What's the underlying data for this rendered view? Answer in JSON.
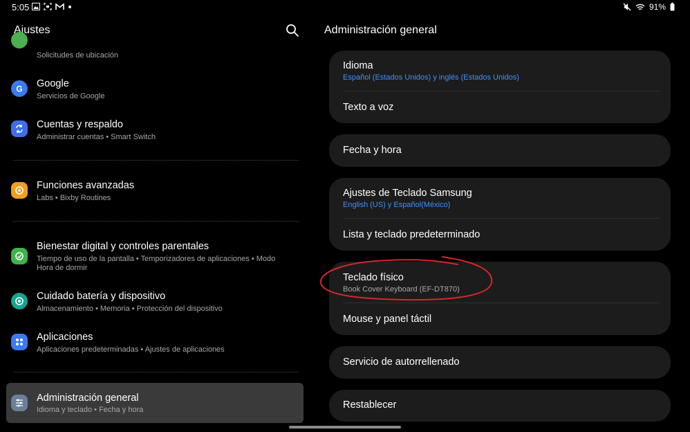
{
  "status_bar": {
    "time": "5:05",
    "battery": "91%",
    "left_icons": [
      "image-icon",
      "screenshot-icon",
      "gmail-icon",
      "dot-icon"
    ],
    "right_icons": [
      "mute-icon",
      "wifi-icon",
      "battery-icon"
    ]
  },
  "left_panel": {
    "title": "Ajustes",
    "items": [
      {
        "title": "",
        "subtitle": "Solicitudes de ubicación",
        "icon": "location-icon",
        "color": "#4caf50"
      },
      {
        "title": "Google",
        "subtitle": "Servicios de Google",
        "icon": "google-icon",
        "color": "#3a7bf0"
      },
      {
        "title": "Cuentas y respaldo",
        "subtitle": "Administrar cuentas  •  Smart Switch",
        "icon": "sync-icon",
        "color": "#3f6fe8"
      },
      {
        "title": "Funciones avanzadas",
        "subtitle": "Labs  •  Bixby Routines",
        "icon": "star-gear-icon",
        "color": "#f0a020"
      },
      {
        "title": "Bienestar digital y controles parentales",
        "subtitle": "Tiempo de uso de la pantalla  •  Temporizadores de aplicaciones  •  Modo Hora de dormir",
        "icon": "wellbeing-icon",
        "color": "#3fb24c"
      },
      {
        "title": "Cuidado batería y dispositivo",
        "subtitle": "Almacenamiento  •  Memoria  •  Protección del dispositivo",
        "icon": "device-care-icon",
        "color": "#17a58e"
      },
      {
        "title": "Aplicaciones",
        "subtitle": "Aplicaciones predeterminadas  •  Ajustes de aplicaciones",
        "icon": "apps-icon",
        "color": "#3a7bf0"
      },
      {
        "title": "Administración general",
        "subtitle": "Idioma y teclado  •  Fecha y hora",
        "icon": "sliders-icon",
        "color": "#6a7f9a"
      }
    ]
  },
  "right_panel": {
    "title": "Administración general",
    "cards": [
      {
        "items": [
          {
            "title": "Idioma",
            "subtitle": "Español (Estados Unidos) y inglés (Estados Unidos)"
          },
          {
            "title": "Texto a voz",
            "subtitle": ""
          }
        ]
      },
      {
        "items": [
          {
            "title": "Fecha y hora",
            "subtitle": ""
          }
        ]
      },
      {
        "items": [
          {
            "title": "Ajustes de Teclado Samsung",
            "subtitle": "English (US) y Español(México)"
          },
          {
            "title": "Lista y teclado predeterminado",
            "subtitle": ""
          }
        ]
      },
      {
        "items": [
          {
            "title": "Teclado físico",
            "subtitle": "Book Cover Keyboard (EF-DT870)"
          },
          {
            "title": "Mouse y panel táctil",
            "subtitle": ""
          }
        ]
      },
      {
        "items": [
          {
            "title": "Servicio de autorrellenado",
            "subtitle": ""
          }
        ]
      },
      {
        "items": [
          {
            "title": "Restablecer",
            "subtitle": ""
          }
        ]
      }
    ]
  },
  "colors": {
    "accent_blue": "#3e91ff",
    "annotation_red": "#d8262a",
    "card_bg": "#1c1c1c",
    "selected_bg": "#3a3a3a"
  }
}
